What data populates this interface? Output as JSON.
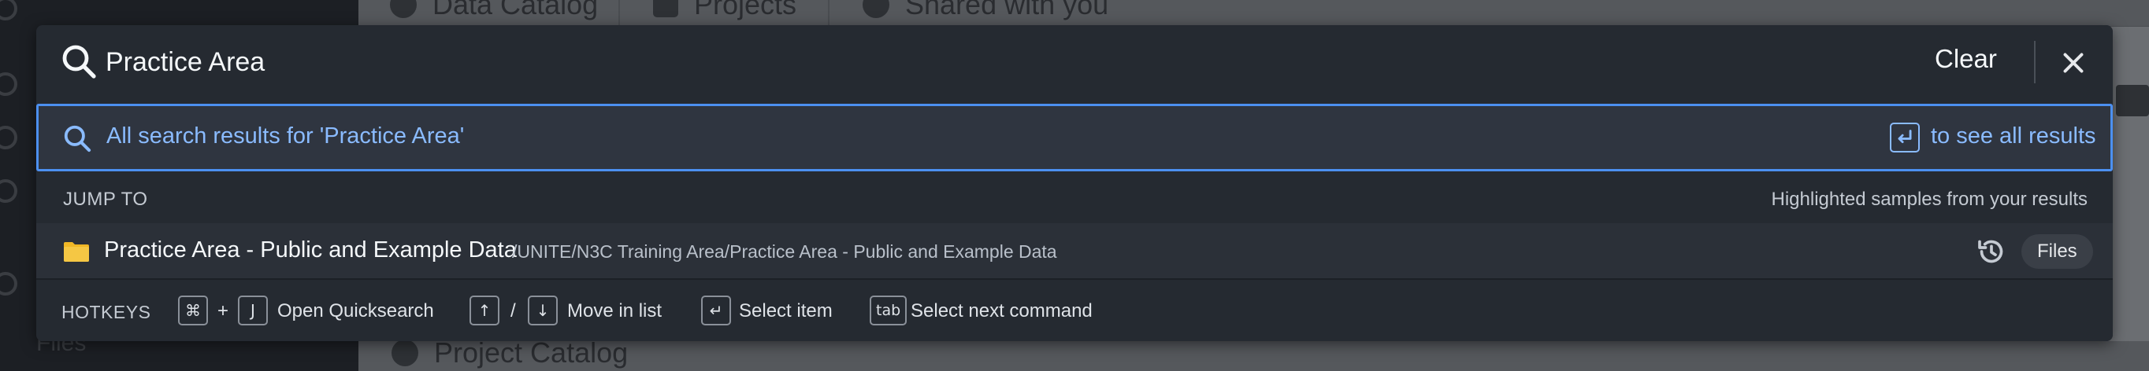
{
  "background": {
    "tabs": [
      "Data Catalog",
      "Projects",
      "Shared with you"
    ],
    "bottom_item": "Project Catalog",
    "sidebar_bottom_label": "Files"
  },
  "search": {
    "query": "Practice Area",
    "clear_label": "Clear"
  },
  "all_results": {
    "label": "All search results for 'Practice Area'",
    "see_all_label": "to see all results"
  },
  "section": {
    "title": "JUMP TO",
    "hint": "Highlighted samples from your results"
  },
  "result": {
    "title": "Practice Area - Public and Example Data",
    "path": "/UNITE/N3C Training Area/Practice Area - Public and Example Data",
    "tag": "Files"
  },
  "hotkeys": {
    "label": "HOTKEYS",
    "cmd_key": "⌘",
    "plus": "+",
    "j_key": "J",
    "open_label": "Open Quicksearch",
    "up_key": "↑",
    "slash": "/",
    "down_key": "↓",
    "move_label": "Move in list",
    "enter_key": "↵",
    "select_label": "Select item",
    "tab_key": "tab",
    "next_label": "Select next command"
  },
  "colors": {
    "accent": "#8abbff",
    "focus_border": "#4c90f0",
    "folder": "#f0b726",
    "overlay_bg": "#252a31"
  }
}
